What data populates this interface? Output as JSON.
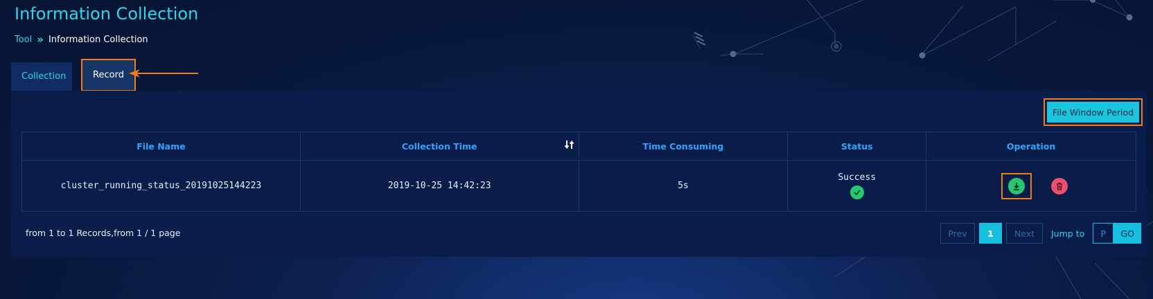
{
  "header": {
    "title": "Information Collection"
  },
  "breadcrumb": {
    "root": "Tool",
    "separator": "»",
    "current": "Information Collection"
  },
  "tabs": [
    {
      "label": "Collection",
      "active": false
    },
    {
      "label": "Record",
      "active": true,
      "highlighted": true
    }
  ],
  "toolbar": {
    "file_window_label": "File Window Period"
  },
  "table": {
    "columns": [
      "File Name",
      "Collection Time",
      "Time Consuming",
      "Status",
      "Operation"
    ],
    "rows": [
      {
        "file_name": "cluster_running_status_20191025144223",
        "collection_time": "2019-10-25 14:42:23",
        "time_consuming": "5s",
        "status": "Success"
      }
    ]
  },
  "pagination": {
    "summary": "from 1 to 1 Records,from 1 / 1 page",
    "prev_label": "Prev",
    "current_page": "1",
    "next_label": "Next",
    "jump_label": "Jump to",
    "jump_placeholder": "P",
    "go_label": "GO"
  },
  "icons": {
    "sort": "sort-icon",
    "status_success": "check-circle-icon",
    "download": "download-icon",
    "delete": "trash-icon",
    "annotation_arrow": "arrow-left-icon"
  },
  "colors": {
    "accent": "#2fd6ea",
    "highlight": "#f07d15",
    "success": "#28c76f",
    "danger": "#ea4f6d",
    "background": "#071432"
  }
}
